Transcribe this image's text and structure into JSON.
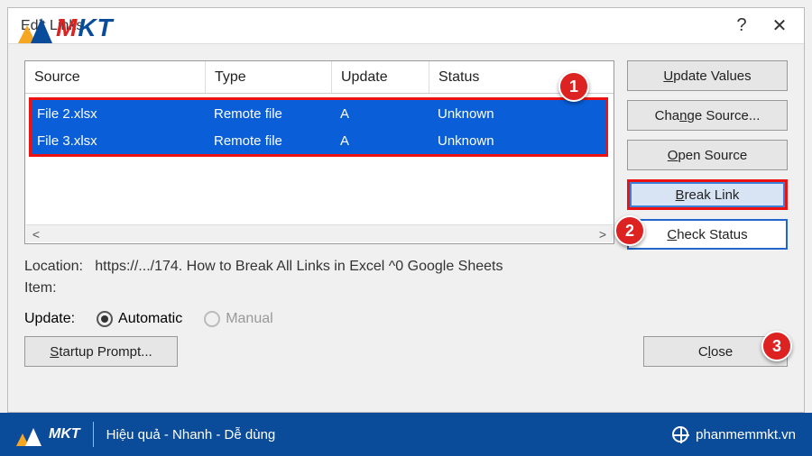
{
  "dialog": {
    "title": "Edit Links",
    "help_glyph": "?",
    "close_glyph": "✕"
  },
  "columns": {
    "source": "Source",
    "type": "Type",
    "update": "Update",
    "status": "Status"
  },
  "rows": [
    {
      "source": "File 2.xlsx",
      "type": "Remote file",
      "update": "A",
      "status": "Unknown"
    },
    {
      "source": "File 3.xlsx",
      "type": "Remote file",
      "update": "A",
      "status": "Unknown"
    }
  ],
  "buttons": {
    "update_values_pre": "",
    "update_values_ul": "U",
    "update_values_post": "pdate Values",
    "change_source_pre": "Cha",
    "change_source_ul": "n",
    "change_source_post": "ge Source...",
    "open_source_pre": "",
    "open_source_ul": "O",
    "open_source_post": "pen Source",
    "break_link_pre": "",
    "break_link_ul": "B",
    "break_link_post": "reak Link",
    "check_status_pre": "",
    "check_status_ul": "C",
    "check_status_post": "heck Status",
    "startup_prompt_pre": "",
    "startup_prompt_ul": "S",
    "startup_prompt_post": "tartup Prompt...",
    "close_pre": "C",
    "close_ul": "l",
    "close_post": "ose"
  },
  "meta": {
    "location_label": "Location:",
    "location_value": "https://.../174. How to Break All Links in Excel ^0 Google Sheets",
    "item_label": "Item:",
    "update_label": "Update:",
    "automatic_pre": "",
    "automatic_ul": "A",
    "automatic_post": "utomatic",
    "manual": "Manual"
  },
  "badges": {
    "b1": "1",
    "b2": "2",
    "b3": "3"
  },
  "footer": {
    "brand": "MKT",
    "slogan": "Hiệu quả - Nhanh  - Dễ dùng",
    "site": "phanmemmkt.vn"
  },
  "top_brand": {
    "m": "M",
    "kt": "KT"
  }
}
